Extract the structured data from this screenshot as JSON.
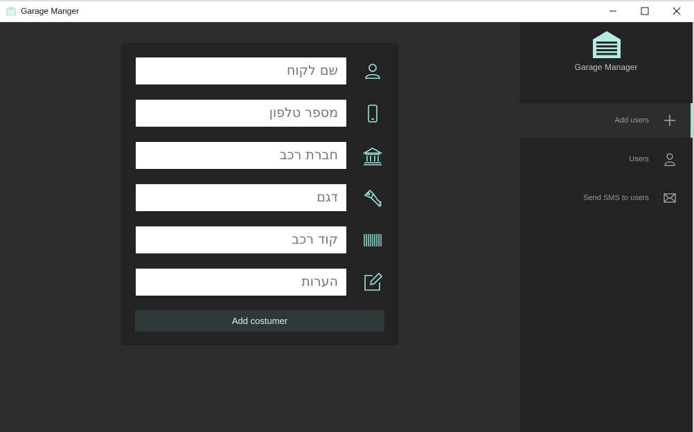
{
  "window": {
    "title": "Garage Manger"
  },
  "form": {
    "fields": [
      {
        "name": "customer-name",
        "placeholder": "שם לקוח",
        "icon": "person-icon"
      },
      {
        "name": "phone",
        "placeholder": "מספר טלפון",
        "icon": "phone-icon"
      },
      {
        "name": "car-company",
        "placeholder": "חברת רכב",
        "icon": "building-icon"
      },
      {
        "name": "model",
        "placeholder": "דגם",
        "icon": "key-icon"
      },
      {
        "name": "car-code",
        "placeholder": "קוד רכב",
        "icon": "barcode-icon"
      },
      {
        "name": "notes",
        "placeholder": "הערות",
        "icon": "edit-icon"
      }
    ],
    "submit_label": "Add costumer"
  },
  "sidebar": {
    "logo_text": "Garage Manager",
    "items": [
      {
        "label": "Add users",
        "icon": "plus-icon",
        "active": true
      },
      {
        "label": "Users",
        "icon": "user-icon",
        "active": false
      },
      {
        "label": "Send SMS to users",
        "icon": "mail-icon",
        "active": false
      }
    ]
  },
  "colors": {
    "accent": "#9de5df",
    "background": "#2d2d2d",
    "panel": "#232323",
    "button": "#2f3838"
  }
}
